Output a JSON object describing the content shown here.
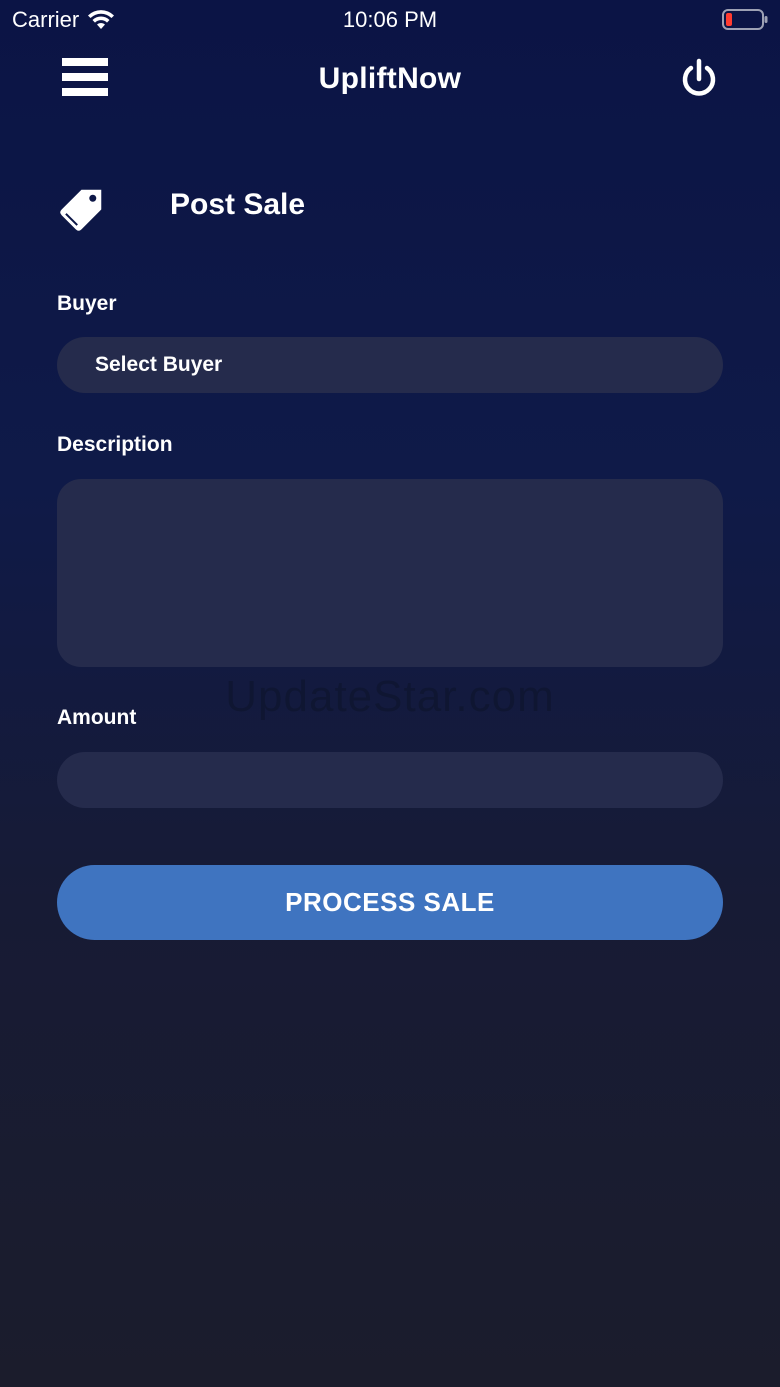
{
  "status_bar": {
    "carrier": "Carrier",
    "time": "10:06 PM",
    "battery_color": "#ff3b30"
  },
  "header": {
    "title": "UpliftNow",
    "menu_icon": "hamburger-menu-icon",
    "power_icon": "power-icon"
  },
  "page": {
    "title": "Post Sale",
    "icon": "price-tag-icon"
  },
  "form": {
    "buyer_label": "Buyer",
    "buyer_value": "Select Buyer",
    "description_label": "Description",
    "description_value": "",
    "amount_label": "Amount",
    "amount_value": "",
    "submit_label": "PROCESS SALE"
  },
  "watermark": "UpdateStar.com",
  "colors": {
    "background_top": "#0b1445",
    "background_bottom": "#1b1c2c",
    "field_fill": "#252b4c",
    "accent": "#3f74c0"
  }
}
